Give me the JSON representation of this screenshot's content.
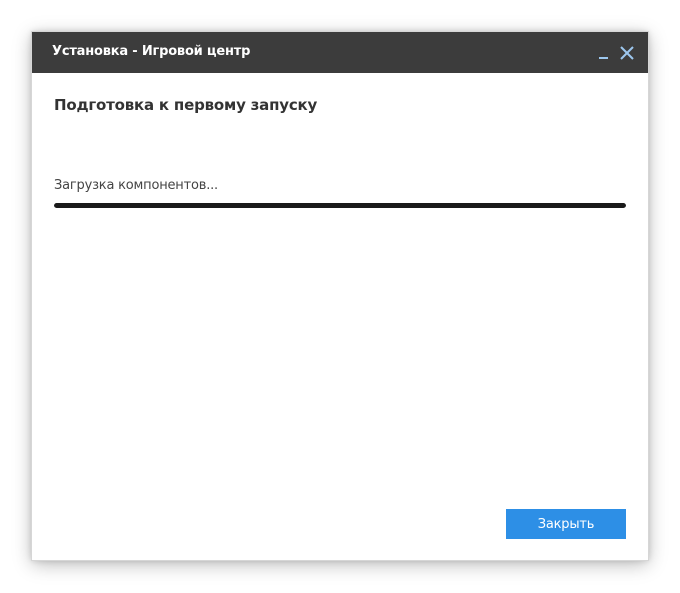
{
  "window": {
    "title": "Установка - Игровой центр"
  },
  "main": {
    "heading": "Подготовка к первому запуску",
    "status_text": "Загрузка компонентов...",
    "progress": 1.0
  },
  "footer": {
    "close_label": "Закрыть"
  },
  "icons": {
    "minimize": "minimize-icon",
    "close": "close-icon"
  },
  "colors": {
    "titlebar": "#3c3c3c",
    "accent_button": "#2d8fe6",
    "window_controls": "#9dc7ee",
    "progress_fill": "#1a1a1a"
  }
}
